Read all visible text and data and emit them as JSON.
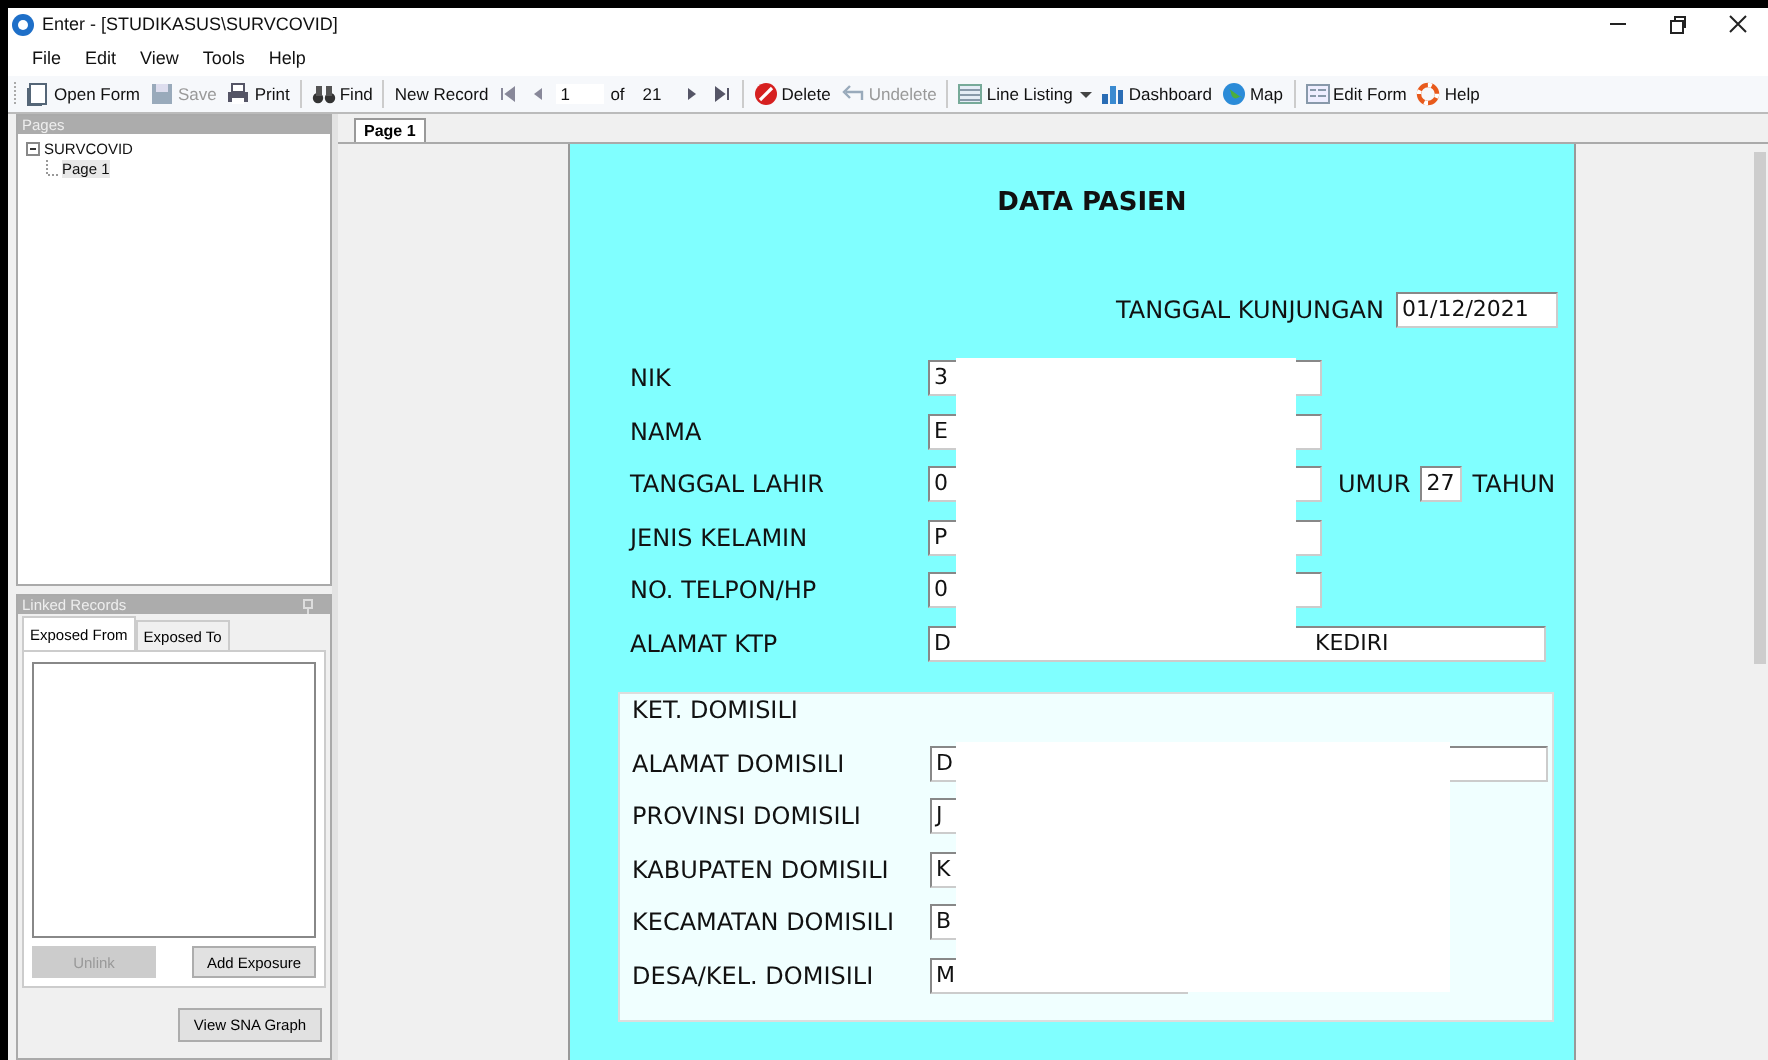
{
  "window": {
    "title": "Enter - [STUDIKASUS\\SURVCOVID]"
  },
  "menu": [
    "File",
    "Edit",
    "View",
    "Tools",
    "Help"
  ],
  "toolbar": [
    {
      "kind": "button",
      "label": "Open Form",
      "has_icon": true,
      "disabled": false
    },
    {
      "kind": "button",
      "label": "Save",
      "has_icon": true,
      "disabled": true
    },
    {
      "kind": "button",
      "label": "Print",
      "has_icon": true,
      "disabled": false
    },
    {
      "kind": "separator"
    },
    {
      "kind": "button",
      "label": "Find",
      "has_icon": true,
      "disabled": false
    },
    {
      "kind": "separator"
    },
    {
      "kind": "button",
      "label": "New Record",
      "has_icon": false,
      "disabled": false
    },
    {
      "kind": "first"
    },
    {
      "kind": "prev"
    },
    {
      "kind": "field",
      "value": "1"
    },
    {
      "kind": "text",
      "label": "of"
    },
    {
      "kind": "text",
      "label": "21"
    },
    {
      "kind": "next"
    },
    {
      "kind": "last"
    },
    {
      "kind": "separator"
    },
    {
      "kind": "button",
      "label": "Delete",
      "has_icon": true,
      "disabled": false
    },
    {
      "kind": "button",
      "label": "Undelete",
      "has_icon": true,
      "disabled": true
    },
    {
      "kind": "separator"
    },
    {
      "kind": "button",
      "label": "Line Listing",
      "has_icon": true,
      "disabled": false
    },
    {
      "kind": "dropdown"
    },
    {
      "kind": "button",
      "label": "Dashboard",
      "has_icon": true,
      "disabled": false
    },
    {
      "kind": "button",
      "label": "Map",
      "has_icon": true,
      "disabled": false
    },
    {
      "kind": "separator"
    },
    {
      "kind": "button",
      "label": "Edit Form",
      "has_icon": true,
      "disabled": false
    },
    {
      "kind": "button",
      "label": "Help",
      "has_icon": true,
      "disabled": false
    }
  ],
  "pages_panel": {
    "title": "Pages",
    "tree": [
      {
        "label": "SURVCOVID",
        "expanded": true,
        "children": [
          {
            "label": "Page 1",
            "selected": true
          }
        ]
      }
    ]
  },
  "linked_records": {
    "title": "Linked Records",
    "tabs": [
      {
        "label": "Exposed From",
        "selected": true
      },
      {
        "label": "Exposed To",
        "selected": false
      }
    ],
    "buttons": [
      {
        "label": "Unlink",
        "disabled": true
      },
      {
        "label": "Add Exposure",
        "disabled": false
      }
    ],
    "graph_button": "View SNA Graph"
  },
  "document_tabs": [
    {
      "label": "Page 1",
      "selected": true
    }
  ],
  "form": {
    "title": "DATA PASIEN",
    "visit_date": {
      "label": "TANGGAL KUNJUNGAN",
      "value": "01/12/2021"
    },
    "patient": {
      "redacted": true,
      "fields": [
        {
          "label": "NIK",
          "value": "3",
          "wide": false
        },
        {
          "label": "NAMA",
          "value": "E",
          "wide": false
        },
        {
          "label": "TANGGAL LAHIR",
          "value": "0",
          "wide": false,
          "age": {
            "label": "UMUR",
            "value": "27",
            "unit": "TAHUN"
          }
        },
        {
          "label": "JENIS KELAMIN",
          "value": "P",
          "wide": false
        },
        {
          "label": "NO. TELPON/HP",
          "value": "0",
          "wide": false
        },
        {
          "label": "ALAMAT KTP",
          "value": "D",
          "tail": "KEDIRI",
          "wide": true
        }
      ]
    },
    "domicile": {
      "title": "KET. DOMISILI",
      "redacted": true,
      "fields": [
        {
          "label": "ALAMAT DOMISILI",
          "value": "D",
          "wide": true
        },
        {
          "label": "PROVINSI DOMISILI",
          "value": "J",
          "wide": false
        },
        {
          "label": "KABUPATEN DOMISILI",
          "value": "K",
          "wide": false
        },
        {
          "label": "KECAMATAN DOMISILI",
          "value": "B",
          "wide": false
        },
        {
          "label": "DESA/KEL. DOMISILI",
          "value": "M",
          "wide": false,
          "short": true
        }
      ]
    }
  }
}
